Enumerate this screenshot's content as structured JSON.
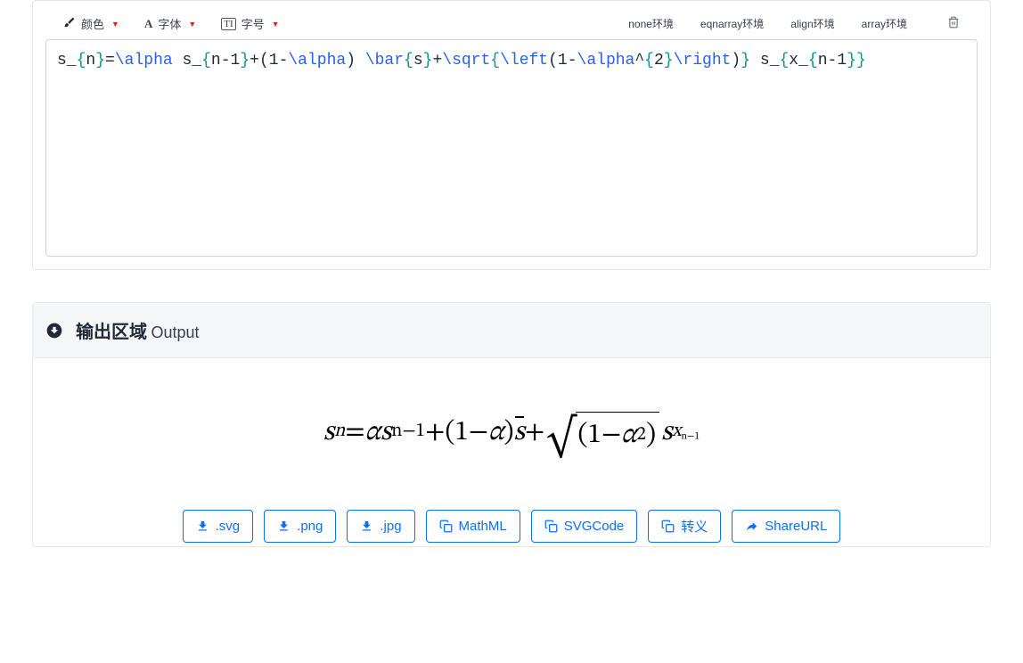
{
  "toolbar": {
    "color_label": "颜色",
    "font_label": "字体",
    "size_label": "字号",
    "env_none": "none环境",
    "env_eqnarray": "eqnarray环境",
    "env_align": "align环境",
    "env_array": "array环境"
  },
  "latex": {
    "t1": "s_",
    "b1": "{",
    "t2": "n",
    "b2": "}",
    "eq": "=",
    "cmd1": "\\alpha",
    "t3": " s_",
    "b3": "{",
    "t4": "n",
    "op1": "-",
    "t5": "1",
    "b4": "}",
    "op2": "+(",
    "t6": "1",
    "op3": "-",
    "cmd2": "\\alpha",
    "op4": ") ",
    "cmd3": "\\bar",
    "b5": "{",
    "t7": "s",
    "b6": "}",
    "op5": "+",
    "cmd4": "\\sqrt",
    "b7": "{",
    "cmd5": "\\left",
    "op6": "(",
    "t8": "1",
    "op7": "-",
    "cmd6": "\\alpha",
    "op8": "^",
    "b8": "{",
    "t9": "2",
    "b9": "}",
    "cmd7": "\\right",
    "op9": ")",
    "b10": "}",
    "t10": " s_",
    "b11": "{",
    "t11": "x",
    "op10": "_",
    "b12": "{",
    "t12": "n",
    "op11": "-",
    "t13": "1",
    "b13": "}",
    "b14": "}"
  },
  "output": {
    "title": "输出区域",
    "subtitle": "Output"
  },
  "rendered": {
    "s": "s",
    "n": "n",
    "eq": " = ",
    "alpha": "α",
    "nm1": "n−1",
    "plus": " + ",
    "lp": "(",
    "one": "1",
    "minus": " − ",
    "rp": ")",
    "sbar": "s",
    "sqrt_sym": "√",
    "two": "2",
    "x": "x"
  },
  "export": {
    "svg": ".svg",
    "png": ".png",
    "jpg": ".jpg",
    "mathml": "MathML",
    "svgcode": "SVGCode",
    "escape": "转义",
    "shareurl": "ShareURL"
  }
}
